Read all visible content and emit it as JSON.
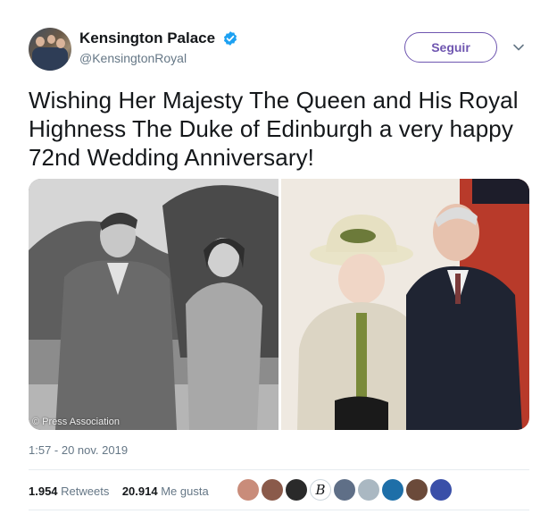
{
  "account": {
    "name": "Kensington Palace",
    "handle": "@KensingtonRoyal",
    "follow_label": "Seguir"
  },
  "tweet": {
    "text": "Wishing Her Majesty The Queen and His Royal Highness The Duke of Edinburgh a very happy 72nd Wedding Anniversary!",
    "photo_credit": "© Press Association",
    "timestamp": "1:57 - 20 nov. 2019"
  },
  "stats": {
    "retweets_count": "1.954",
    "retweets_label": "Retweets",
    "likes_count": "20.914",
    "likes_label": "Me gusta"
  },
  "likers": [
    {
      "color": "#c98c7a"
    },
    {
      "color": "#8a5a4a"
    },
    {
      "color": "#2a2a2a"
    },
    {
      "color": "#ffffff",
      "letter": "B"
    },
    {
      "color": "#5f6f87"
    },
    {
      "color": "#aab8c2"
    },
    {
      "color": "#1e6fa8"
    },
    {
      "color": "#6b4a3a"
    },
    {
      "color": "#3a4fa8"
    }
  ],
  "colors": {
    "follow_purple": "#6f56b0",
    "verified_blue": "#1da1f2",
    "secondary_text": "#657786"
  }
}
